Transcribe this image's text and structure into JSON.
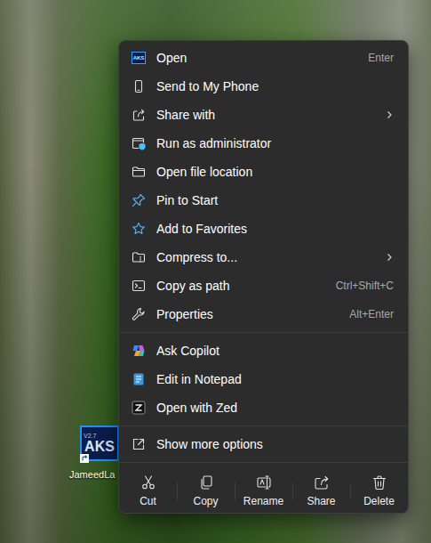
{
  "desktop": {
    "icon": {
      "label": "JameedLa",
      "logo_text": "AKS",
      "version": "V2.7",
      "shortcut": true
    }
  },
  "context_menu": {
    "sections": [
      {
        "items": [
          {
            "label": "Open",
            "shortcut": "Enter",
            "submenu": false
          },
          {
            "label": "Send to My Phone",
            "shortcut": "",
            "submenu": false
          },
          {
            "label": "Share with",
            "shortcut": "",
            "submenu": true
          },
          {
            "label": "Run as administrator",
            "shortcut": "",
            "submenu": false
          },
          {
            "label": "Open file location",
            "shortcut": "",
            "submenu": false
          },
          {
            "label": "Pin to Start",
            "shortcut": "",
            "submenu": false
          },
          {
            "label": "Add to Favorites",
            "shortcut": "",
            "submenu": false
          },
          {
            "label": "Compress to...",
            "shortcut": "",
            "submenu": true
          },
          {
            "label": "Copy as path",
            "shortcut": "Ctrl+Shift+C",
            "submenu": false
          },
          {
            "label": "Properties",
            "shortcut": "Alt+Enter",
            "submenu": false
          }
        ]
      },
      {
        "items": [
          {
            "label": "Ask Copilot",
            "shortcut": "",
            "submenu": false
          },
          {
            "label": "Edit in Notepad",
            "shortcut": "",
            "submenu": false
          },
          {
            "label": "Open with Zed",
            "shortcut": "",
            "submenu": false
          }
        ]
      },
      {
        "items": [
          {
            "label": "Show more options",
            "shortcut": "",
            "submenu": false
          }
        ]
      }
    ],
    "actions": [
      {
        "label": "Cut"
      },
      {
        "label": "Copy"
      },
      {
        "label": "Rename"
      },
      {
        "label": "Share"
      },
      {
        "label": "Delete"
      }
    ]
  }
}
